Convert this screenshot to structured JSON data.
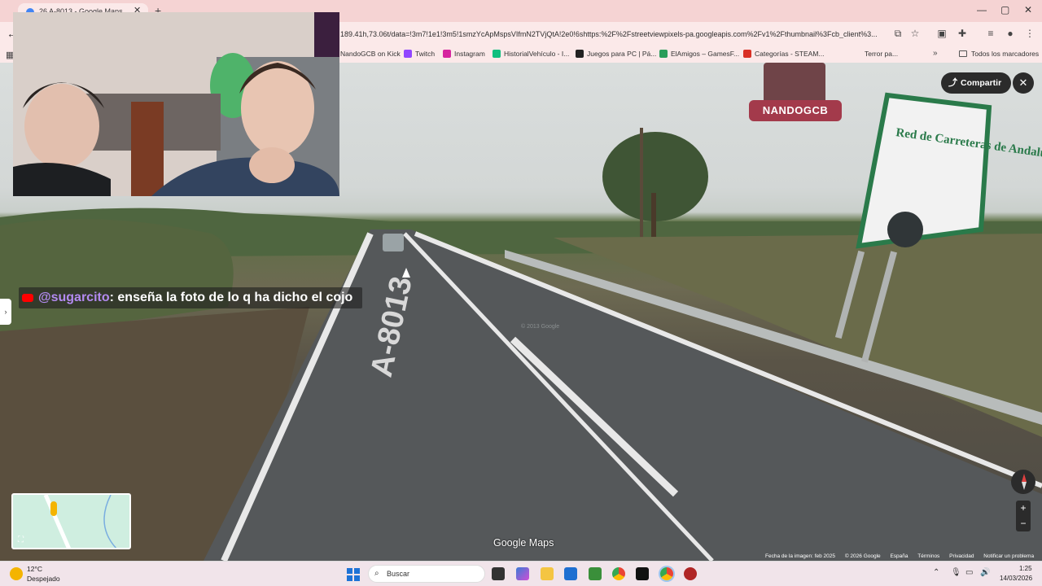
{
  "browser": {
    "tab_title": "26 A-8013 - Google Maps",
    "tab_close": "✕",
    "new_tab": "+",
    "window_controls": [
      "—",
      "▢",
      "✕"
    ],
    "url": "189.41h,73.06t/data=!3m7!1e1!3m5!1smzYcApMspsVIfmN2TVjQtA!2e0!6shttps:%2F%2Fstreetviewpixels-pa.googleapis.com%2Fv1%2Fthumbnail%3Fcb_client%3...",
    "bookmarks": [
      {
        "label": "NandoGCB on Kick",
        "color": "#53fc18"
      },
      {
        "label": "Twitch",
        "color": "#9146ff"
      },
      {
        "label": "Instagram",
        "color": "#d6249f"
      },
      {
        "label": "HistorialVehículo - I...",
        "color": "#0fbf7f"
      },
      {
        "label": "Juegos para PC | Pá...",
        "color": "#222222"
      },
      {
        "label": "ElAmigos – GamesF...",
        "color": "#2a9d5a"
      },
      {
        "label": "Categorías - STEAM...",
        "color": "#d93025"
      },
      {
        "label": "Terror pa...",
        "color": "#777777"
      }
    ],
    "bookmarks_more": "»",
    "all_bookmarks": "Todos los marcadores"
  },
  "streetview": {
    "share_label": "Compartir",
    "close_label": "✕",
    "road_marking": "A-8013",
    "sign_text": "Red de Carreteras de Andalucía",
    "zoom_in": "+",
    "zoom_out": "−",
    "logo": "Google Maps",
    "copyright_overlay": "© 2013 Google",
    "footer": [
      "Fecha de la imagen: feb 2025",
      "© 2026 Google",
      "España",
      "Términos",
      "Privacidad",
      "Notificar un problema"
    ]
  },
  "stream_overlay": {
    "chat_user": "@sugarcito",
    "chat_text": ": enseña la foto de lo q ha dicho el cojo",
    "watermark": "NANDOGCB"
  },
  "taskbar": {
    "weather_temp": "12°C",
    "weather_desc": "Despejado",
    "search_placeholder": "Buscar",
    "time": "1:25",
    "date": "14/03/2026"
  }
}
